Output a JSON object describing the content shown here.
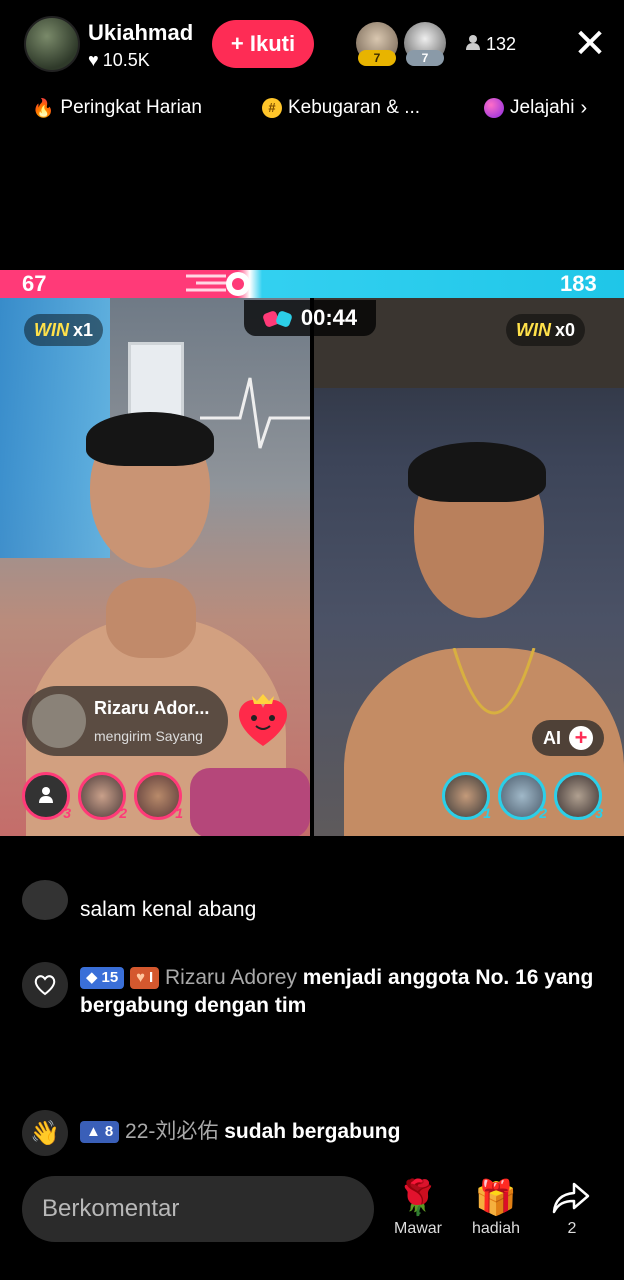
{
  "header": {
    "host_name": "Ukiahmad",
    "host_likes": "10.5K",
    "follow_label": "+ Ikuti",
    "top_viewers": [
      {
        "badge": "7",
        "badge_color": "#e8b400"
      },
      {
        "badge": "7",
        "badge_color": "#8a9aa8"
      }
    ],
    "viewer_count": "132",
    "close_label": "✕"
  },
  "topics": [
    {
      "label": "Peringkat Harian",
      "icon": "fire-icon"
    },
    {
      "label": "Kebugaran & ...",
      "icon": "hashtag-icon"
    },
    {
      "label": "Jelajahi",
      "icon": "planet-icon"
    }
  ],
  "battle": {
    "left_score": "67",
    "right_score": "183",
    "timer": "00:44",
    "left_win_word": "WIN",
    "left_win_count": "x1",
    "right_win_word": "WIN",
    "right_win_count": "x0",
    "pink_color": "#ff3a78",
    "cyan_color": "#2ccfe8"
  },
  "gift_notification": {
    "sender": "Rizaru Ador...",
    "message": "mengirim Sayang"
  },
  "left_ranks": [
    "3",
    "2",
    "1"
  ],
  "right_ranks": [
    "1",
    "2",
    "3"
  ],
  "ai_label": "AI",
  "chat": [
    {
      "text": "salam kenal abang"
    },
    {
      "badge1": "15",
      "badge2": "I",
      "user": "Rizaru Adorey",
      "text": "menjadi anggota No. 16 yang bergabung dengan tim"
    },
    {
      "badge1": "8",
      "user": "22-刘必佑",
      "text": "sudah bergabung"
    }
  ],
  "bottom": {
    "comment_placeholder": "Berkomentar",
    "rose_label": "Mawar",
    "gift_label": "hadiah",
    "share_count": "2"
  }
}
